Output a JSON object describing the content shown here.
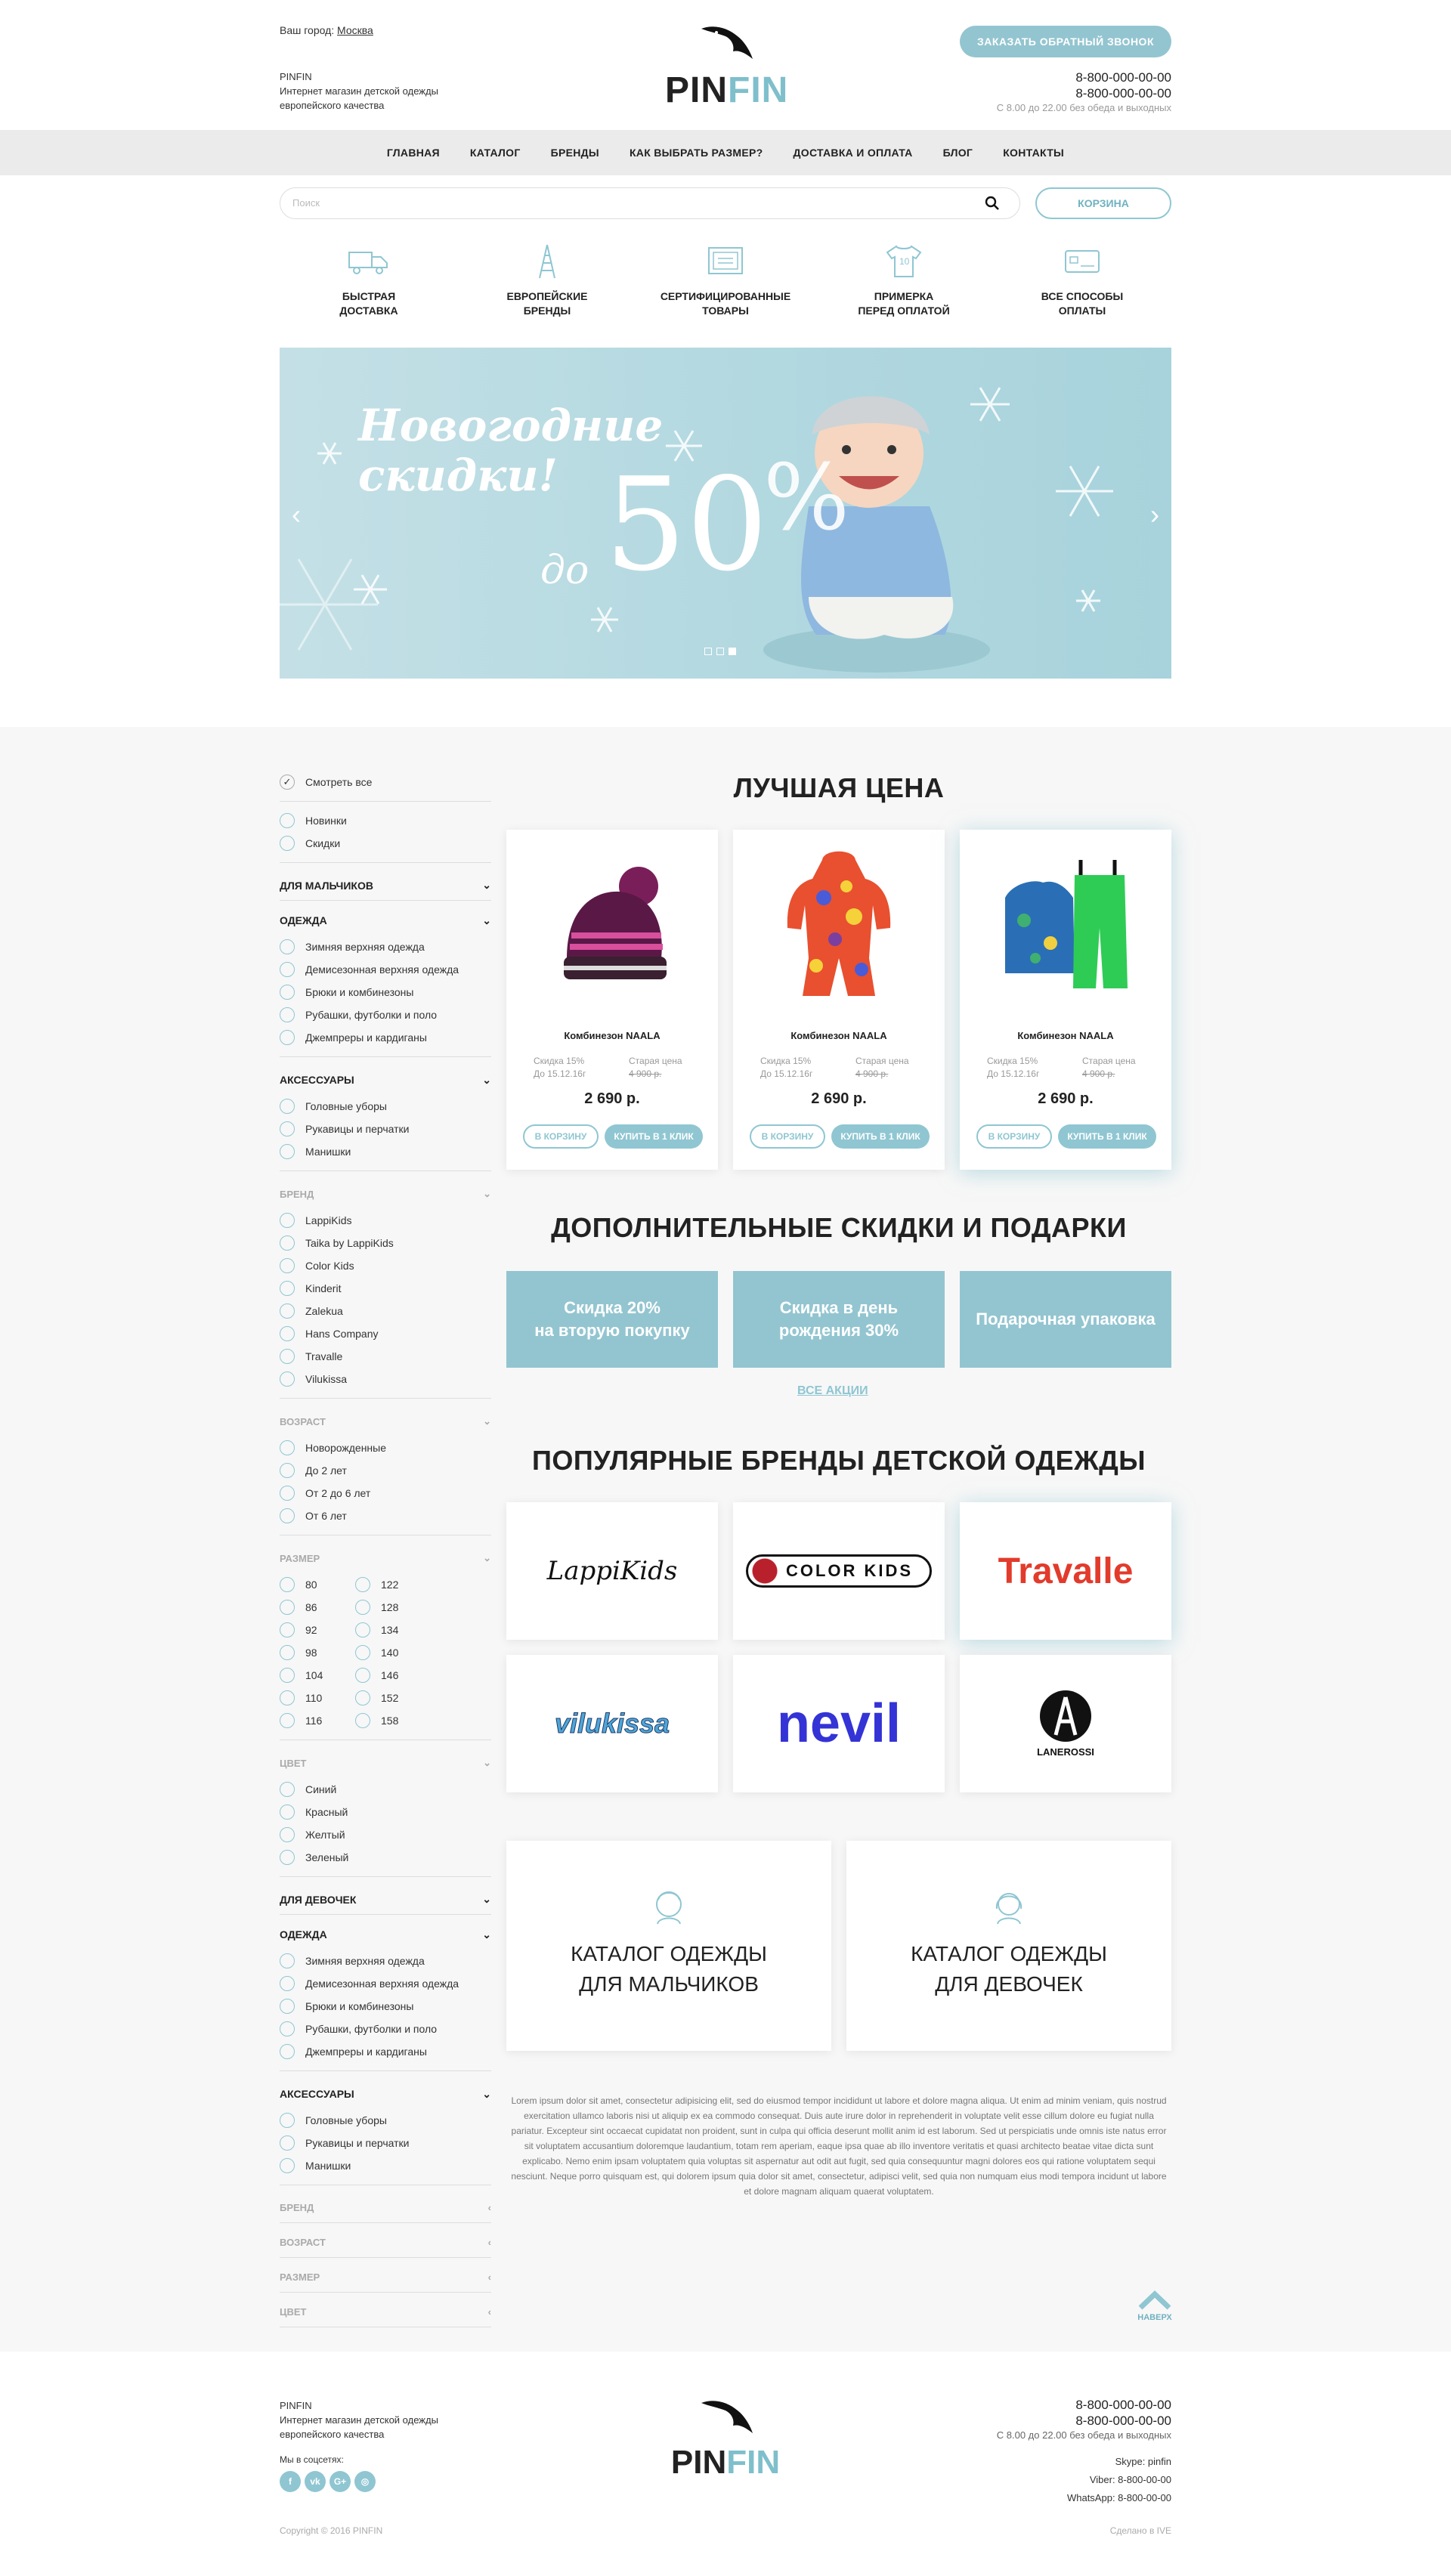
{
  "header": {
    "city_label": "Ваш город:",
    "city": "Москва",
    "brand_name": "PINFIN",
    "brand_desc": "Интернет магазин детской одежды европейского качества",
    "logo_a": "PIN",
    "logo_b": "FIN",
    "callback": "ЗАКАЗАТЬ ОБРАТНЫЙ ЗВОНОК",
    "phone1": "8-800-000-00-00",
    "phone2": "8-800-000-00-00",
    "hours": "С 8.00 до 22.00 без обеда и выходных"
  },
  "nav": [
    "ГЛАВНАЯ",
    "КАТАЛОГ",
    "БРЕНДЫ",
    "КАК ВЫБРАТЬ РАЗМЕР?",
    "ДОСТАВКА И ОПЛАТА",
    "БЛОГ",
    "КОНТАКТЫ"
  ],
  "search": {
    "placeholder": "Поиск",
    "cart": "КОРЗИНА"
  },
  "features": [
    {
      "l1": "БЫСТРАЯ",
      "l2": "ДОСТАВКА",
      "icon": "truck-icon"
    },
    {
      "l1": "ЕВРОПЕЙСКИЕ",
      "l2": "БРЕНДЫ",
      "icon": "eiffel-tower-icon"
    },
    {
      "l1": "СЕРТИФИЦИРОВАННЫЕ",
      "l2": "ТОВАРЫ",
      "icon": "certificate-icon"
    },
    {
      "l1": "ПРИМЕРКА",
      "l2": "ПЕРЕД ОПЛАТОЙ",
      "icon": "tshirt-icon"
    },
    {
      "l1": "ВСЕ СПОСОБЫ",
      "l2": "ОПЛАТЫ",
      "icon": "card-icon"
    }
  ],
  "banner": {
    "line1": "Новогодние",
    "line2": "скидки!",
    "do": "до",
    "num": "50",
    "pct": "%"
  },
  "sidebar": {
    "view_all": "Смотреть все",
    "top": [
      "Новинки",
      "Скидки"
    ],
    "boys": "ДЛЯ МАЛЬЧИКОВ",
    "clothes": "ОДЕЖДА",
    "clothes_items": [
      "Зимняя верхняя одежда",
      "Демисезонная верхняя одежда",
      "Брюки и комбинезоны",
      "Рубашки, футболки и поло",
      "Джемпреры и кардиганы"
    ],
    "acc": "АКСЕССУАРЫ",
    "acc_items": [
      "Головные уборы",
      "Рукавицы и перчатки",
      "Манишки"
    ],
    "brand": "БРЕНД",
    "brand_items": [
      "LappiKids",
      "Taika by LappiKids",
      "Color Kids",
      "Kinderit",
      "Zalekua",
      "Hans Company",
      "Travalle",
      "Vilukissa"
    ],
    "age": "ВОЗРАСТ",
    "age_items": [
      "Новорожденные",
      "До 2 лет",
      "От 2 до 6 лет",
      "От 6 лет"
    ],
    "size": "РАЗМЕР",
    "size_items": [
      "80",
      "122",
      "86",
      "128",
      "92",
      "134",
      "98",
      "140",
      "104",
      "146",
      "110",
      "152",
      "116",
      "158"
    ],
    "color": "ЦВЕТ",
    "color_items": [
      "Синий",
      "Красный",
      "Желтый",
      "Зеленый"
    ],
    "girls": "ДЛЯ ДЕВОЧЕК"
  },
  "best": {
    "title": "ЛУЧШАЯ ЦЕНА",
    "products": [
      {
        "name": "Комбинезон NAALA",
        "disc": "Скидка 15%",
        "until": "До 15.12.16г",
        "old_label": "Старая цена",
        "old": "4 900 р.",
        "price": "2 690 р.",
        "cart": "В КОРЗИНУ",
        "buy": "КУПИТЬ В 1 КЛИК"
      },
      {
        "name": "Комбинезон NAALA",
        "disc": "Скидка 15%",
        "until": "До 15.12.16г",
        "old_label": "Старая цена",
        "old": "4 900 р.",
        "price": "2 690 р.",
        "cart": "В КОРЗИНУ",
        "buy": "КУПИТЬ В 1 КЛИК"
      },
      {
        "name": "Комбинезон NAALA",
        "disc": "Скидка 15%",
        "until": "До 15.12.16г",
        "old_label": "Старая цена",
        "old": "4 900 р.",
        "price": "2 690 р.",
        "cart": "В КОРЗИНУ",
        "buy": "КУПИТЬ В 1 КЛИК"
      }
    ]
  },
  "promos": {
    "title": "ДОПОЛНИТЕЛЬНЫЕ СКИДКИ И ПОДАРКИ",
    "items": [
      {
        "l1": "Скидка 20%",
        "l2": "на вторую покупку"
      },
      {
        "l1": "Скидка в день",
        "l2": "рождения 30%"
      },
      {
        "l1": "Подарочная упаковка",
        "l2": ""
      }
    ],
    "all": "ВСЕ АКЦИИ"
  },
  "brands": {
    "title": "ПОПУЛЯРНЫЕ БРЕНДЫ ДЕТСКОЙ ОДЕЖДЫ",
    "items": [
      "LappiKids",
      "COLOR KIDS",
      "Travalle",
      "vilukissa",
      "nevil",
      "LANEROSSI"
    ]
  },
  "catalogs": [
    {
      "l1": "КАТАЛОГ ОДЕЖДЫ",
      "l2": "ДЛЯ МАЛЬЧИКОВ"
    },
    {
      "l1": "КАТАЛОГ ОДЕЖДЫ",
      "l2": "ДЛЯ ДЕВОЧЕК"
    }
  ],
  "lorem": "Lorem ipsum dolor sit amet, consectetur adipisicing elit, sed do eiusmod tempor incididunt ut labore et dolore magna aliqua. Ut enim ad minim veniam, quis nostrud exercitation ullamco laboris nisi ut aliquip ex ea commodo consequat. Duis aute irure dolor in reprehenderit in voluptate velit esse cillum dolore eu fugiat nulla pariatur. Excepteur sint occaecat cupidatat non proident, sunt in culpa qui officia deserunt mollit anim id est laborum. Sed ut perspiciatis unde omnis iste natus error sit voluptatem accusantium doloremque laudantium, totam rem aperiam, eaque ipsa quae ab illo inventore veritatis et quasi architecto beatae vitae dicta sunt explicabo. Nemo enim ipsam voluptatem quia voluptas sit aspernatur aut odit aut fugit, sed quia consequuntur magni dolores eos qui ratione voluptatem sequi nesciunt. Neque porro quisquam est, qui dolorem ipsum quia dolor sit amet, consectetur, adipisci velit, sed quia non numquam eius modi tempora incidunt ut labore et dolore magnam aliquam quaerat voluptatem.",
  "up": "НАВЕРХ",
  "footer": {
    "brand_name": "PINFIN",
    "brand_desc": "Интернет магазин детской одежды европейского качества",
    "social": "Мы в соцсетях:",
    "copyright": "Copyright © 2016 PINFIN",
    "phone1": "8-800-000-00-00",
    "phone2": "8-800-000-00-00",
    "hours": "С 8.00 до 22.00 без обеда и выходных",
    "skype": "Skype: pinfin",
    "viber": "Viber: 8-800-00-00",
    "whatsapp": "WhatsApp: 8-800-00-00",
    "made": "Сделано в IVE"
  },
  "colors": {
    "accent": "#93c5d0",
    "nav_bg": "#ebebeb",
    "section_bg": "#f7f7f7"
  }
}
